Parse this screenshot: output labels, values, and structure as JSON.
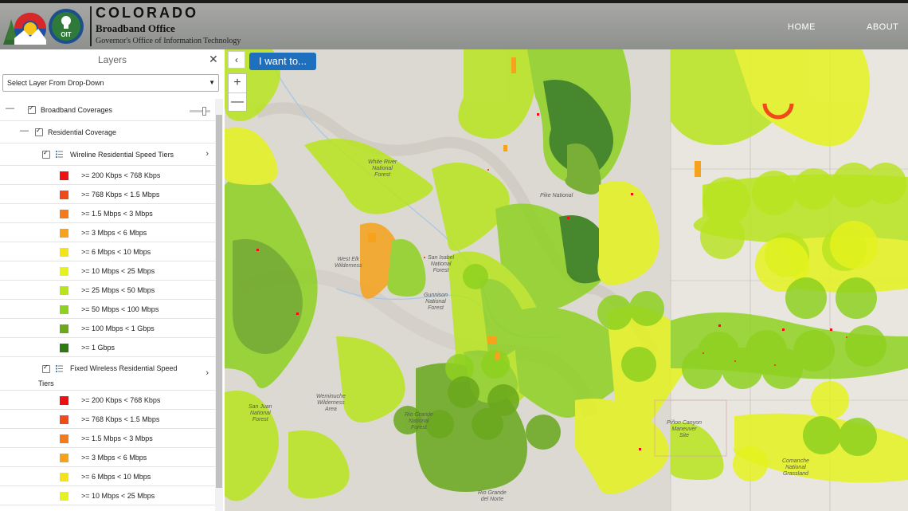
{
  "header": {
    "title": "COLORADO",
    "subtitle": "Broadband Office",
    "tagline": "Governor's Office of Information Technology",
    "oit_badge": "OIT",
    "nav": [
      {
        "label": "HOME"
      },
      {
        "label": "ABOUT"
      }
    ]
  },
  "panel": {
    "title": "Layers",
    "close_icon": "close-icon",
    "select_value": "Select Layer From Drop-Down",
    "tree": {
      "broadband": "Broadband Coverages",
      "residential": "Residential Coverage",
      "wireline": "Wireline Residential Speed Tiers",
      "fixed_wireless_line1": "Fixed Wireless Residential Speed",
      "fixed_wireless_line2": "Tiers"
    },
    "wireline_tiers": [
      {
        "label": ">= 200 Kbps < 768 Kbps",
        "color": "#ee1111"
      },
      {
        "label": ">= 768 Kbps < 1.5 Mbps",
        "color": "#f04a1a"
      },
      {
        "label": ">= 1.5 Mbps < 3 Mbps",
        "color": "#f47a1c"
      },
      {
        "label": ">= 3 Mbps < 6 Mbps",
        "color": "#f6a21c"
      },
      {
        "label": ">= 6 Mbps < 10 Mbps",
        "color": "#f4e21a"
      },
      {
        "label": ">= 10 Mbps < 25 Mbps",
        "color": "#e4f21e"
      },
      {
        "label": ">= 25 Mbps < 50 Mbps",
        "color": "#b8e41e"
      },
      {
        "label": ">= 50 Mbps < 100 Mbps",
        "color": "#8ed120"
      },
      {
        "label": ">= 100 Mbps < 1 Gbps",
        "color": "#6aa81c"
      },
      {
        "label": ">= 1 Gbps",
        "color": "#2e7a12"
      }
    ],
    "fixed_wireless_tiers": [
      {
        "label": ">= 200 Kbps < 768 Kbps",
        "color": "#ee1111"
      },
      {
        "label": ">= 768 Kbps < 1.5 Mbps",
        "color": "#f04a1a"
      },
      {
        "label": ">= 1.5 Mbps < 3 Mbps",
        "color": "#f47a1c"
      },
      {
        "label": ">= 3 Mbps < 6 Mbps",
        "color": "#f6a21c"
      },
      {
        "label": ">= 6 Mbps < 10 Mbps",
        "color": "#f4e21a"
      },
      {
        "label": ">= 10 Mbps < 25 Mbps",
        "color": "#e4f21e"
      }
    ]
  },
  "map": {
    "i_want_label": "I want to...",
    "collapse_icon": "chevron-left-icon",
    "zoom_in": "+",
    "zoom_out": "—",
    "labels": {
      "white_river": "White River\nNational\nForest",
      "pike": "Pike National",
      "san_isabel": "San Isabel\nNational\nForest",
      "gunnison": "Gunnison\nNational\nForest",
      "west_elk": "West Elk\nWilderness",
      "rio_grande": "Rio Grande\nNational\nForest",
      "san_juan": "San Juan\nNational\nForest",
      "weminuche": "Weminuche\nWilderness\nArea",
      "pinon": "Piñon Canyon\nManeuver\nSite",
      "comanche": "Comanche\nNational\nGrassland",
      "rio_norte": "Rio Grande\ndel Norte"
    }
  }
}
